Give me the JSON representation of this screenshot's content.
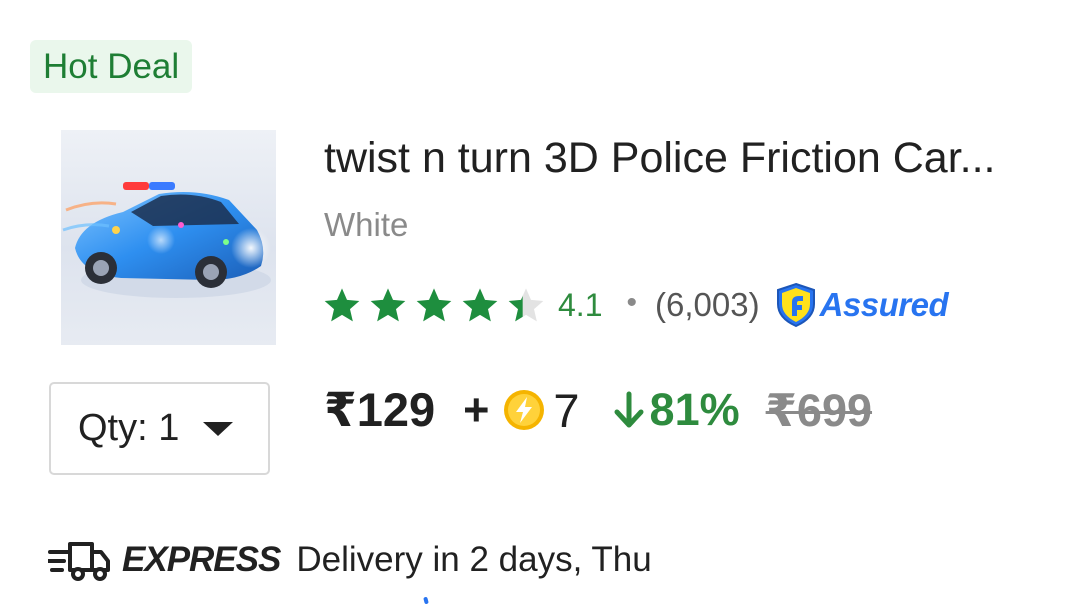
{
  "badge": {
    "label": "Hot Deal"
  },
  "product": {
    "title": "twist n turn 3D Police Friction Car...",
    "variant": "White",
    "rating": {
      "value": "4.1",
      "separator": "•",
      "count": "(6,003)",
      "stars": 4.1,
      "star_color": "#1e8e3e"
    },
    "assured": {
      "label": "Assured",
      "color": "#2874f0"
    },
    "image_icon": "police-toy-car-image"
  },
  "quantity": {
    "label": "Qty: 1"
  },
  "pricing": {
    "price": "₹129",
    "plus": "+",
    "coins": "7",
    "discount": "81%",
    "mrp": "₹699",
    "discount_color": "#2e8b3e"
  },
  "delivery": {
    "express_label": "EXPRESS",
    "text": "Delivery in 2 days, Thu",
    "icon": "express-truck-icon"
  }
}
